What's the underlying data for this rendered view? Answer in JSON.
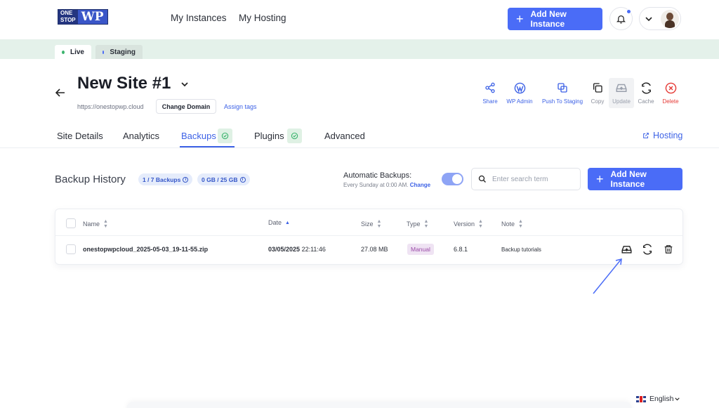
{
  "logo": {
    "left_top": "ONE",
    "left_bottom": "STOP",
    "right": "WP"
  },
  "nav": {
    "my_instances": "My Instances",
    "my_hosting": "My Hosting",
    "add_new_instance": "Add New Instance"
  },
  "env": {
    "live": "Live",
    "staging": "Staging"
  },
  "site": {
    "title": "New Site #1",
    "url": "https://onestopwp.cloud",
    "change_domain": "Change Domain",
    "assign_tags": "Assign tags"
  },
  "actions": {
    "share": "Share",
    "wp_admin": "WP Admin",
    "push_to_staging": "Push To Staging",
    "copy": "Copy",
    "update": "Update",
    "cache": "Cache",
    "delete": "Delete"
  },
  "tabs": {
    "site_details": "Site Details",
    "analytics": "Analytics",
    "backups": "Backups",
    "plugins": "Plugins",
    "advanced": "Advanced",
    "hosting": "Hosting"
  },
  "backup_history": {
    "title": "Backup History",
    "backups_pill": "1 / 7 Backups",
    "storage_pill": "0 GB / 25 GB",
    "auto_title": "Automatic Backups:",
    "auto_schedule": "Every Sunday at 0:00 AM.",
    "auto_change": "Change",
    "search_placeholder": "Enter search term",
    "add_button": "Add New Instance"
  },
  "table": {
    "headers": {
      "name": "Name",
      "date": "Date",
      "size": "Size",
      "type": "Type",
      "version": "Version",
      "note": "Note"
    },
    "rows": [
      {
        "name": "onestopwpcloud_2025-05-03_19-11-55.zip",
        "date": "03/05/2025",
        "time": "22:11:46",
        "size": "27.08 MB",
        "type": "Manual",
        "version": "6.8.1",
        "note": "Backup tutorials"
      }
    ]
  },
  "footer": {
    "language": "English"
  },
  "colors": {
    "primary": "#4a6cf7",
    "danger": "#e53935",
    "env_bar": "#e4f1ea"
  }
}
